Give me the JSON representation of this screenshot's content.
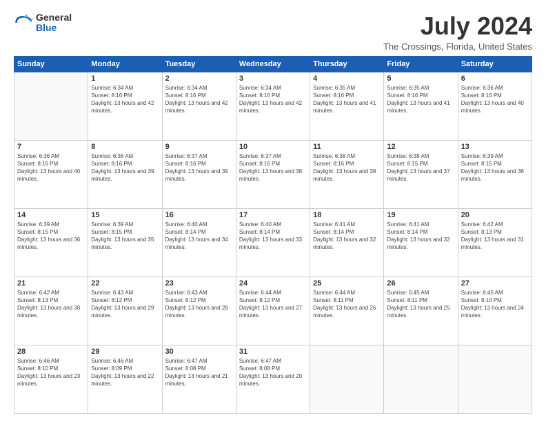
{
  "logo": {
    "general": "General",
    "blue": "Blue"
  },
  "title": "July 2024",
  "location": "The Crossings, Florida, United States",
  "days_of_week": [
    "Sunday",
    "Monday",
    "Tuesday",
    "Wednesday",
    "Thursday",
    "Friday",
    "Saturday"
  ],
  "weeks": [
    [
      {
        "day": "",
        "sunrise": "",
        "sunset": "",
        "daylight": ""
      },
      {
        "day": "1",
        "sunrise": "Sunrise: 6:34 AM",
        "sunset": "Sunset: 8:16 PM",
        "daylight": "Daylight: 13 hours and 42 minutes."
      },
      {
        "day": "2",
        "sunrise": "Sunrise: 6:34 AM",
        "sunset": "Sunset: 8:16 PM",
        "daylight": "Daylight: 13 hours and 42 minutes."
      },
      {
        "day": "3",
        "sunrise": "Sunrise: 6:34 AM",
        "sunset": "Sunset: 8:16 PM",
        "daylight": "Daylight: 13 hours and 42 minutes."
      },
      {
        "day": "4",
        "sunrise": "Sunrise: 6:35 AM",
        "sunset": "Sunset: 8:16 PM",
        "daylight": "Daylight: 13 hours and 41 minutes."
      },
      {
        "day": "5",
        "sunrise": "Sunrise: 6:35 AM",
        "sunset": "Sunset: 8:16 PM",
        "daylight": "Daylight: 13 hours and 41 minutes."
      },
      {
        "day": "6",
        "sunrise": "Sunrise: 6:36 AM",
        "sunset": "Sunset: 8:16 PM",
        "daylight": "Daylight: 13 hours and 40 minutes."
      }
    ],
    [
      {
        "day": "7",
        "sunrise": "Sunrise: 6:36 AM",
        "sunset": "Sunset: 8:16 PM",
        "daylight": "Daylight: 13 hours and 40 minutes."
      },
      {
        "day": "8",
        "sunrise": "Sunrise: 6:36 AM",
        "sunset": "Sunset: 8:16 PM",
        "daylight": "Daylight: 13 hours and 39 minutes."
      },
      {
        "day": "9",
        "sunrise": "Sunrise: 6:37 AM",
        "sunset": "Sunset: 8:16 PM",
        "daylight": "Daylight: 13 hours and 39 minutes."
      },
      {
        "day": "10",
        "sunrise": "Sunrise: 6:37 AM",
        "sunset": "Sunset: 8:16 PM",
        "daylight": "Daylight: 13 hours and 38 minutes."
      },
      {
        "day": "11",
        "sunrise": "Sunrise: 6:38 AM",
        "sunset": "Sunset: 8:16 PM",
        "daylight": "Daylight: 13 hours and 38 minutes."
      },
      {
        "day": "12",
        "sunrise": "Sunrise: 6:38 AM",
        "sunset": "Sunset: 8:15 PM",
        "daylight": "Daylight: 13 hours and 37 minutes."
      },
      {
        "day": "13",
        "sunrise": "Sunrise: 6:39 AM",
        "sunset": "Sunset: 8:15 PM",
        "daylight": "Daylight: 13 hours and 36 minutes."
      }
    ],
    [
      {
        "day": "14",
        "sunrise": "Sunrise: 6:39 AM",
        "sunset": "Sunset: 8:15 PM",
        "daylight": "Daylight: 13 hours and 36 minutes."
      },
      {
        "day": "15",
        "sunrise": "Sunrise: 6:39 AM",
        "sunset": "Sunset: 8:15 PM",
        "daylight": "Daylight: 13 hours and 35 minutes."
      },
      {
        "day": "16",
        "sunrise": "Sunrise: 6:40 AM",
        "sunset": "Sunset: 8:14 PM",
        "daylight": "Daylight: 13 hours and 34 minutes."
      },
      {
        "day": "17",
        "sunrise": "Sunrise: 6:40 AM",
        "sunset": "Sunset: 8:14 PM",
        "daylight": "Daylight: 13 hours and 33 minutes."
      },
      {
        "day": "18",
        "sunrise": "Sunrise: 6:41 AM",
        "sunset": "Sunset: 8:14 PM",
        "daylight": "Daylight: 13 hours and 32 minutes."
      },
      {
        "day": "19",
        "sunrise": "Sunrise: 6:41 AM",
        "sunset": "Sunset: 8:14 PM",
        "daylight": "Daylight: 13 hours and 32 minutes."
      },
      {
        "day": "20",
        "sunrise": "Sunrise: 6:42 AM",
        "sunset": "Sunset: 8:13 PM",
        "daylight": "Daylight: 13 hours and 31 minutes."
      }
    ],
    [
      {
        "day": "21",
        "sunrise": "Sunrise: 6:42 AM",
        "sunset": "Sunset: 8:13 PM",
        "daylight": "Daylight: 13 hours and 30 minutes."
      },
      {
        "day": "22",
        "sunrise": "Sunrise: 6:43 AM",
        "sunset": "Sunset: 8:12 PM",
        "daylight": "Daylight: 13 hours and 29 minutes."
      },
      {
        "day": "23",
        "sunrise": "Sunrise: 6:43 AM",
        "sunset": "Sunset: 8:12 PM",
        "daylight": "Daylight: 13 hours and 28 minutes."
      },
      {
        "day": "24",
        "sunrise": "Sunrise: 6:44 AM",
        "sunset": "Sunset: 8:12 PM",
        "daylight": "Daylight: 13 hours and 27 minutes."
      },
      {
        "day": "25",
        "sunrise": "Sunrise: 6:44 AM",
        "sunset": "Sunset: 8:11 PM",
        "daylight": "Daylight: 13 hours and 26 minutes."
      },
      {
        "day": "26",
        "sunrise": "Sunrise: 6:45 AM",
        "sunset": "Sunset: 8:11 PM",
        "daylight": "Daylight: 13 hours and 25 minutes."
      },
      {
        "day": "27",
        "sunrise": "Sunrise: 6:45 AM",
        "sunset": "Sunset: 8:10 PM",
        "daylight": "Daylight: 13 hours and 24 minutes."
      }
    ],
    [
      {
        "day": "28",
        "sunrise": "Sunrise: 6:46 AM",
        "sunset": "Sunset: 8:10 PM",
        "daylight": "Daylight: 13 hours and 23 minutes."
      },
      {
        "day": "29",
        "sunrise": "Sunrise: 6:46 AM",
        "sunset": "Sunset: 8:09 PM",
        "daylight": "Daylight: 13 hours and 22 minutes."
      },
      {
        "day": "30",
        "sunrise": "Sunrise: 6:47 AM",
        "sunset": "Sunset: 8:08 PM",
        "daylight": "Daylight: 13 hours and 21 minutes."
      },
      {
        "day": "31",
        "sunrise": "Sunrise: 6:47 AM",
        "sunset": "Sunset: 8:08 PM",
        "daylight": "Daylight: 13 hours and 20 minutes."
      },
      {
        "day": "",
        "sunrise": "",
        "sunset": "",
        "daylight": ""
      },
      {
        "day": "",
        "sunrise": "",
        "sunset": "",
        "daylight": ""
      },
      {
        "day": "",
        "sunrise": "",
        "sunset": "",
        "daylight": ""
      }
    ]
  ]
}
